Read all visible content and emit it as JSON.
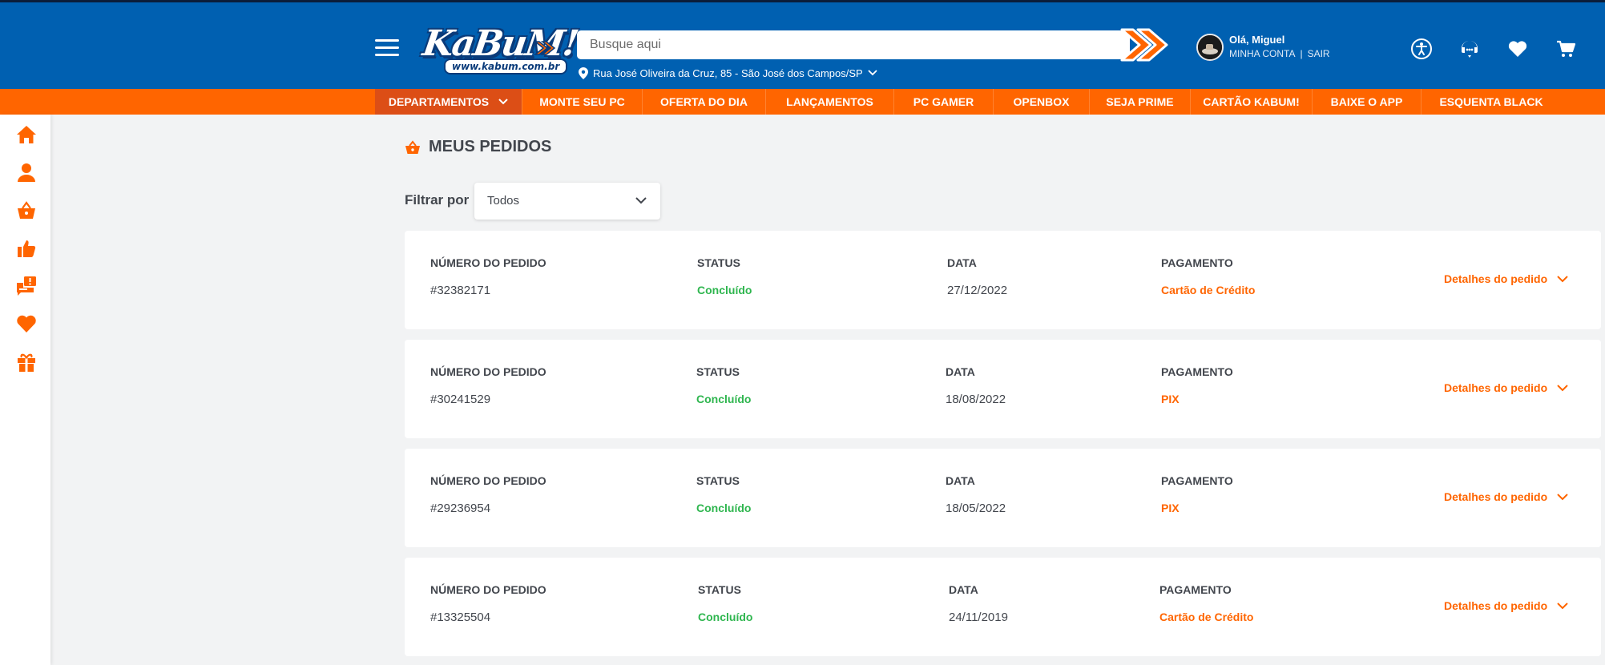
{
  "colors": {
    "header_blue": "#0060b1",
    "nav_orange": "#ff6500",
    "nav_dept_orange": "#dc4e16",
    "status_green": "#2fb64f",
    "text_dark": "#42464d",
    "page_bg": "#f2f3f4"
  },
  "header": {
    "logo_text": "KaBuM!",
    "logo_subtext": "www.kabum.com.br",
    "search_placeholder": "Busque aqui",
    "address": "Rua José Oliveira da Cruz, 85 - São José dos Campos/SP",
    "greeting": "Olá, Miguel",
    "my_account": "MINHA CONTA",
    "separator": "|",
    "logout": "SAIR",
    "icons": [
      "menu-icon",
      "search-arrow-icon",
      "location-pin-icon",
      "accessibility-icon",
      "support-chat-icon",
      "heart-icon",
      "cart-icon"
    ]
  },
  "nav": {
    "items": [
      {
        "label": "DEPARTAMENTOS"
      },
      {
        "label": "MONTE SEU PC"
      },
      {
        "label": "OFERTA DO DIA"
      },
      {
        "label": "LANÇAMENTOS"
      },
      {
        "label": "PC GAMER"
      },
      {
        "label": "OPENBOX"
      },
      {
        "label": "SEJA PRIME"
      },
      {
        "label": "CARTÃO KABUM!"
      },
      {
        "label": "BAIXE O APP"
      },
      {
        "label": "ESQUENTA BLACK"
      }
    ]
  },
  "sidebar": {
    "icons": [
      "home-icon",
      "user-icon",
      "basket-icon",
      "thumbs-up-icon",
      "chat-alert-icon",
      "heart-icon",
      "gift-icon"
    ]
  },
  "main": {
    "title": "MEUS PEDIDOS",
    "filter_label": "Filtrar por",
    "filter_value": "Todos",
    "columns": {
      "order_number": "NÚMERO DO PEDIDO",
      "status": "STATUS",
      "date": "DATA",
      "payment": "PAGAMENTO"
    },
    "details_label": "Detalhes do pedido",
    "orders": [
      {
        "number": "#32382171",
        "status": "Concluído",
        "date": "27/12/2022",
        "payment": "Cartão de Crédito"
      },
      {
        "number": "#30241529",
        "status": "Concluído",
        "date": "18/08/2022",
        "payment": "PIX"
      },
      {
        "number": "#29236954",
        "status": "Concluído",
        "date": "18/05/2022",
        "payment": "PIX"
      },
      {
        "number": "#13325504",
        "status": "Concluído",
        "date": "24/11/2019",
        "payment": "Cartão de Crédito"
      }
    ]
  }
}
